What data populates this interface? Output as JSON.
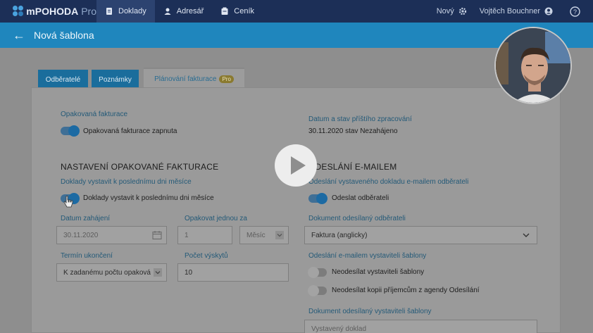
{
  "topbar": {
    "brand": "mPOHODA",
    "brand_pro": "Pro",
    "nav": [
      {
        "label": "Doklady",
        "icon": "document-icon"
      },
      {
        "label": "Adresář",
        "icon": "person-icon"
      },
      {
        "label": "Ceník",
        "icon": "price-list-icon"
      }
    ],
    "new_label": "Nový",
    "user_name": "Vojtěch Bouchner"
  },
  "subbar": {
    "title": "Nová šablona"
  },
  "tabs": [
    {
      "label": "Odběratelé"
    },
    {
      "label": "Poznámky"
    },
    {
      "label": "Plánování fakturace",
      "badge": "Pro"
    }
  ],
  "form": {
    "recurring": {
      "label": "Opakovaná fakturace",
      "toggle_label": "Opakovaná fakturace zapnuta",
      "on": true
    },
    "next": {
      "label": "Datum a stav příštího zpracování",
      "value": "30.11.2020 stav Nezahájeno"
    },
    "settings_heading": "NASTAVENÍ OPAKOVANÉ FAKTURACE",
    "last_day": {
      "label": "Doklady vystavit k poslednímu dni měsíce",
      "toggle_label": "Doklady vystavit k poslednímu dni měsíce",
      "on": true
    },
    "start": {
      "label": "Datum zahájení",
      "value": "30.11.2020"
    },
    "repeat": {
      "label": "Opakovat jednou za",
      "value": "1",
      "unit": "Měsíc"
    },
    "end": {
      "label": "Termín ukončení",
      "value": "K zadanému počtu opaková"
    },
    "count": {
      "label": "Počet výskytů",
      "value": "10"
    },
    "email_heading": "ODESLÁNÍ E-MAILEM",
    "email_customer": {
      "label": "Odeslání vystaveného dokladu e-mailem odběrateli",
      "toggle_label": "Odeslat odběrateli",
      "on": true
    },
    "doc_customer": {
      "label": "Dokument odesílaný odběrateli",
      "value": "Faktura (anglicky)"
    },
    "email_issuer": {
      "label": "Odeslání e-mailem vystaviteli šablony",
      "toggle1_label": "Neodesílat vystaviteli šablony",
      "toggle2_label": "Neodesílat kopii příjemcům z agendy Odesílání"
    },
    "doc_issuer": {
      "label": "Dokument odesílaný vystaviteli šablony",
      "value": "Vystavený doklad"
    }
  }
}
